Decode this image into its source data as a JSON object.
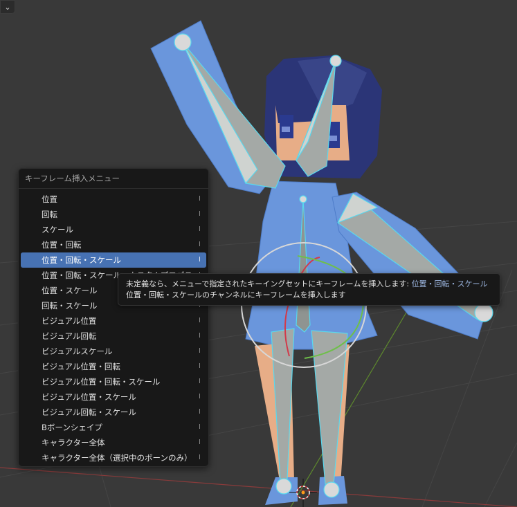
{
  "corner_button": {
    "icon": "chevron-down-icon",
    "glyph": "⌄"
  },
  "menu": {
    "title": "キーフレーム挿入メニュー",
    "items": [
      {
        "label": "位置",
        "shortcut": "I"
      },
      {
        "label": "回転",
        "shortcut": "I"
      },
      {
        "label": "スケール",
        "shortcut": "I"
      },
      {
        "label": "位置・回転",
        "shortcut": "I"
      },
      {
        "label": "位置・回転・スケール",
        "shortcut": "I"
      },
      {
        "label": "位置・回転・スケール・カスタムプロパティ",
        "shortcut": "I"
      },
      {
        "label": "位置・スケール",
        "shortcut": "I"
      },
      {
        "label": "回転・スケール",
        "shortcut": "I"
      },
      {
        "label": "ビジュアル位置",
        "shortcut": "I"
      },
      {
        "label": "ビジュアル回転",
        "shortcut": "I"
      },
      {
        "label": "ビジュアルスケール",
        "shortcut": "I"
      },
      {
        "label": "ビジュアル位置・回転",
        "shortcut": "I"
      },
      {
        "label": "ビジュアル位置・回転・スケール",
        "shortcut": "I"
      },
      {
        "label": "ビジュアル位置・スケール",
        "shortcut": "I"
      },
      {
        "label": "ビジュアル回転・スケール",
        "shortcut": "I"
      },
      {
        "label": "Bボーンシェイプ",
        "shortcut": "I"
      },
      {
        "label": "キャラクター全体",
        "shortcut": "I"
      },
      {
        "label": "キャラクター全体（選択中のボーンのみ）",
        "shortcut": "I"
      }
    ],
    "active_index": 4
  },
  "tooltip": {
    "line1": "未定義なら、メニューで指定されたキーイングセットにキーフレームを挿入します:",
    "line1_highlight": "位置・回転・スケール",
    "line2": "位置・回転・スケールのチャンネルにキーフレームを挿入します"
  },
  "colors": {
    "viewport_bg": "#393939",
    "mesh_blue": "#6a96dc",
    "bone_gray": "#a4a9a6",
    "bone_outline": "#58d8ee",
    "hair": "#2b3577",
    "skin": "#e7ad87",
    "active_highlight": "#4772b3"
  }
}
